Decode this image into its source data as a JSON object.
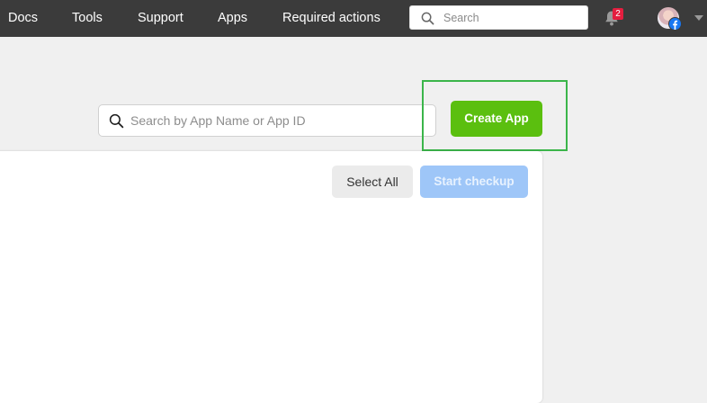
{
  "topbar": {
    "nav": [
      {
        "label": "Docs"
      },
      {
        "label": "Tools"
      },
      {
        "label": "Support"
      },
      {
        "label": "Apps"
      },
      {
        "label": "Required actions"
      }
    ],
    "search": {
      "placeholder": "Search",
      "icon": "search-icon"
    },
    "notifications": {
      "icon": "bell-icon",
      "count": "2"
    },
    "account": {
      "avatar": "profile-photo",
      "badge_icon": "facebook-icon",
      "menu_icon": "caret-down-icon"
    }
  },
  "toolbar": {
    "search": {
      "placeholder": "Search by App Name or App ID",
      "icon": "search-icon"
    },
    "create_label": "Create App"
  },
  "panel": {
    "select_all_label": "Select All",
    "start_checkup_label": "Start checkup"
  },
  "colors": {
    "topbar": "#3b3b3b",
    "page_background": "#f0f0f0",
    "create_button": "#5bbf0f",
    "highlight_outline": "#3bb54a",
    "checkup_button_disabled": "#9ec6f8",
    "notification_badge": "#e41e3f",
    "facebook_blue": "#1877f2"
  }
}
